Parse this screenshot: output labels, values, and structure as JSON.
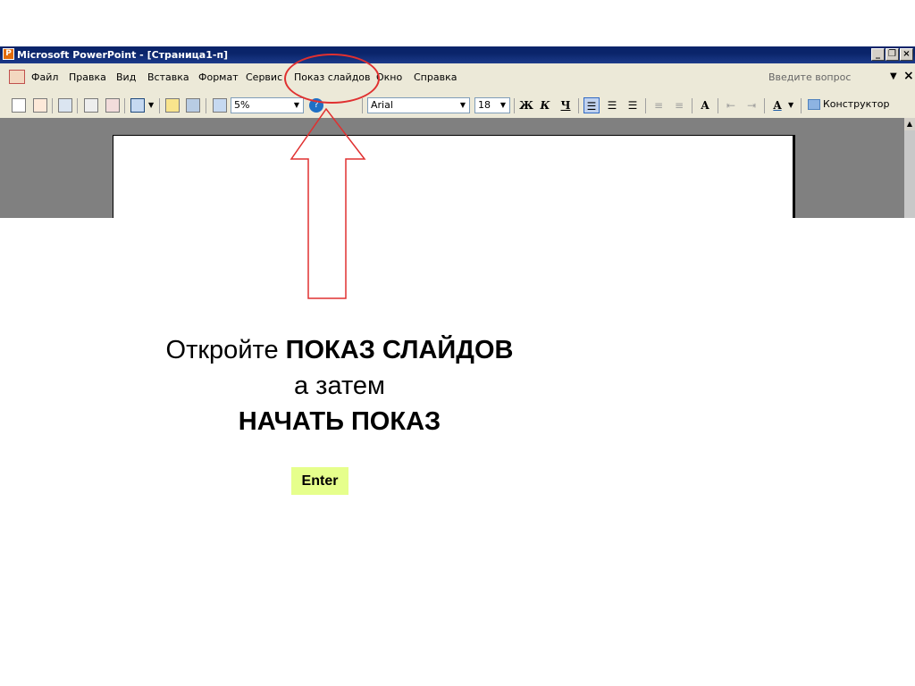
{
  "window": {
    "title": "Microsoft PowerPoint - [Страница1-п]",
    "app_icon_glyph": "P",
    "buttons": [
      "minimize",
      "restore",
      "close"
    ]
  },
  "menubar": {
    "items": [
      {
        "label": "Файл"
      },
      {
        "label": "Правка"
      },
      {
        "label": "Вид"
      },
      {
        "label": "Вставка"
      },
      {
        "label": "Формат"
      },
      {
        "label": "Сервис"
      },
      {
        "label": "Показ слайдов"
      },
      {
        "label": "Окно"
      },
      {
        "label": "Справка"
      }
    ],
    "ask_placeholder": "Введите вопрос",
    "close_glyph": "×"
  },
  "toolbar": {
    "zoom_value": "5%",
    "font_name": "Arial",
    "font_size": "18",
    "bold_label": "Ж",
    "italic_label": "К",
    "underline_label": "Ч",
    "designer_label": "Конструктор"
  },
  "instruction": {
    "line1_prefix": "Откройте ",
    "line1_bold": "ПОКАЗ СЛАЙДОВ",
    "line2": "а затем",
    "line3": "НАЧАТЬ ПОКАЗ"
  },
  "enter_button": {
    "label": "Enter"
  },
  "colors": {
    "title_bar": "#0a246a",
    "menu_bg": "#ece9d8",
    "workspace": "#808080",
    "highlight": "#e03030",
    "enter_bg": "#e6ff8c"
  }
}
